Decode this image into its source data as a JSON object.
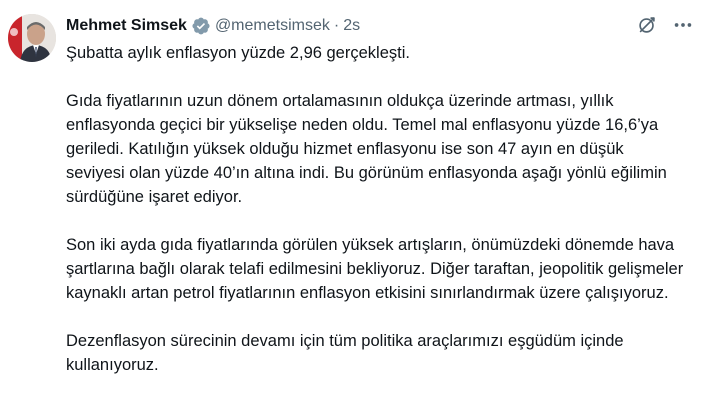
{
  "author": {
    "display_name": "Mehmet Simsek",
    "handle": "@memetsimsek",
    "separator": "·",
    "time": "2s"
  },
  "actions": {
    "grok_icon": "grok-icon",
    "more_icon": "more-options-icon"
  },
  "tweet": {
    "paragraphs": [
      "Şubatta aylık enflasyon yüzde 2,96 gerçekleşti.",
      "Gıda fiyatlarının uzun dönem ortalamasının oldukça üzerinde artması, yıllık enflasyonda geçici bir yükselişe neden oldu. Temel mal enflasyonu yüzde 16,6’ya geriledi. Katılığın yüksek olduğu hizmet enflasyonu ise son 47 ayın en düşük seviyesi olan yüzde 40’ın altına indi. Bu görünüm enflasyonda aşağı yönlü eğilimin sürdüğüne işaret ediyor.",
      "Son iki ayda gıda fiyatlarında görülen yüksek artışların, önümüzdeki dönemde hava şartlarına bağlı olarak telafi edilmesini bekliyoruz. Diğer taraftan, jeopolitik gelişmeler kaynaklı artan petrol fiyatlarının enflasyon etkisini sınırlandırmak üzere çalışıyoruz.",
      "Dezenflasyon sürecinin devamı için tüm politika araçlarımızı eşgüdüm içinde kullanıyoruz."
    ]
  },
  "colors": {
    "text": "#0f1419",
    "secondary": "#536471",
    "verified_badge": "#829aab"
  }
}
